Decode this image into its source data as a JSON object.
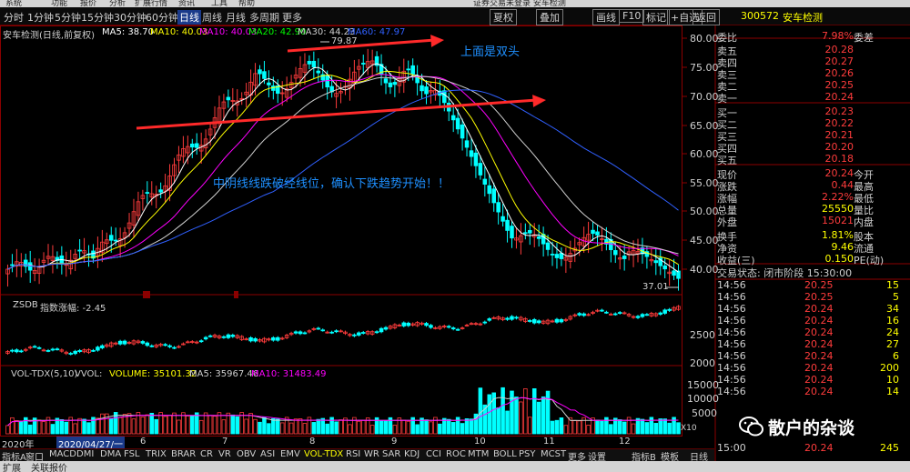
{
  "menu": [
    "系统",
    "功能",
    "报价",
    "分析",
    "扩展行情",
    "资讯",
    "工具",
    "帮助"
  ],
  "window_title": "证券交易未登录  安车检测",
  "periods": [
    {
      "label": "分时",
      "active": false
    },
    {
      "label": "1分钟",
      "active": false
    },
    {
      "label": "5分钟",
      "active": false
    },
    {
      "label": "15分钟",
      "active": false
    },
    {
      "label": "30分钟",
      "active": false
    },
    {
      "label": "60分钟",
      "active": false
    },
    {
      "label": "日线",
      "active": true
    },
    {
      "label": "周线",
      "active": false
    },
    {
      "label": "月线",
      "active": false
    },
    {
      "label": "多周期",
      "active": false
    },
    {
      "label": "更多",
      "active": false
    }
  ],
  "right_toolbar": [
    "夏权",
    "叠加",
    "画线",
    "F10",
    "标记",
    "+自选",
    "返回"
  ],
  "quote_header": {
    "code": "300572",
    "name": "安车检测"
  },
  "chart_header": {
    "name": "安车检测(日线,前复权)",
    "ma5": "MA5: 38.70",
    "ma10": "MA10: 40.03",
    "ma10b": "MA10: 40.03",
    "ma20": "MA20: 42.90",
    "ma30": "MA30: 44.23",
    "ma60": "MA60: 47.97"
  },
  "annotations": {
    "top": "上面是双头",
    "mid": "中阴线线跌破经线位，确认下跌趋势开始！！",
    "high": "79.87",
    "low": "37.01"
  },
  "price_axis": [
    "80.00",
    "75.00",
    "70.00",
    "65.00",
    "60.00",
    "55.00",
    "50.00",
    "45.00",
    "40.00"
  ],
  "zsdb": {
    "name": "ZSDB",
    "label": "指数涨幅: -2.45",
    "axis": [
      "2500",
      "2000"
    ]
  },
  "vol": {
    "name": "VOL-TDX(5,10)",
    "vvol": "VVOL: ",
    "volume": "VOLUME: 35101.32",
    "ma5": "MA5: 35967.46",
    "ma10": "MA10: 31483.49",
    "axis": [
      "15000",
      "10000",
      "5000"
    ],
    "unit": "X10"
  },
  "x_axis": {
    "start": "2020年",
    "selected_date": "2020/04/27/一",
    "months": [
      "6",
      "7",
      "8",
      "9",
      "10",
      "11",
      "12"
    ]
  },
  "quote": {
    "webi": {
      "label": "委比",
      "value": "7.98%",
      "label2": "委差"
    },
    "asks": [
      {
        "label": "卖五",
        "price": "20.28"
      },
      {
        "label": "卖四",
        "price": "20.27"
      },
      {
        "label": "卖三",
        "price": "20.26"
      },
      {
        "label": "卖二",
        "price": "20.25"
      },
      {
        "label": "卖一",
        "price": "20.24"
      }
    ],
    "bids": [
      {
        "label": "买一",
        "price": "20.23"
      },
      {
        "label": "买二",
        "price": "20.22"
      },
      {
        "label": "买三",
        "price": "20.21"
      },
      {
        "label": "买四",
        "price": "20.20"
      },
      {
        "label": "买五",
        "price": "20.18"
      }
    ],
    "stats": [
      {
        "label": "现价",
        "value": "20.24",
        "label2": "今开",
        "color": "red"
      },
      {
        "label": "涨跌",
        "value": "0.44",
        "label2": "最高",
        "color": "red"
      },
      {
        "label": "涨幅",
        "value": "2.22%",
        "label2": "最低",
        "color": "red"
      },
      {
        "label": "总量",
        "value": "25550",
        "label2": "量比",
        "color": "yellow"
      },
      {
        "label": "外盘",
        "value": "15021",
        "label2": "内盘",
        "color": "red"
      }
    ],
    "stats2": [
      {
        "label": "换手",
        "value": "1.81%",
        "label2": "股本",
        "color": "yellow"
      },
      {
        "label": "净资",
        "value": "9.46",
        "label2": "流通",
        "color": "yellow"
      },
      {
        "label": "收益(三)",
        "value": "0.150",
        "label2": "PE(动)",
        "color": "yellow"
      }
    ],
    "trade_state": "交易状态: 闭市阶段  15:30:00"
  },
  "ticks": [
    {
      "time": "14:56",
      "price": "20.25",
      "vol": "15"
    },
    {
      "time": "14:56",
      "price": "20.25",
      "vol": "5"
    },
    {
      "time": "14:56",
      "price": "20.24",
      "vol": "34"
    },
    {
      "time": "14:56",
      "price": "20.24",
      "vol": "16"
    },
    {
      "time": "14:56",
      "price": "20.24",
      "vol": "24"
    },
    {
      "time": "14:56",
      "price": "20.24",
      "vol": "27"
    },
    {
      "time": "14:56",
      "price": "20.24",
      "vol": "6"
    },
    {
      "time": "14:56",
      "price": "20.24",
      "vol": "200"
    },
    {
      "time": "14:56",
      "price": "20.24",
      "vol": "10"
    },
    {
      "time": "14:56",
      "price": "20.24",
      "vol": "14"
    },
    {
      "time": "15:00",
      "price": "20.24",
      "vol": "245"
    }
  ],
  "indicators": [
    "指标A",
    "窗口",
    "MACD",
    "DMI",
    "DMA",
    "FSL",
    "TRIX",
    "BRAR",
    "CR",
    "VR",
    "OBV",
    "ASI",
    "EMV",
    "VOL-TDX",
    "RSI",
    "WR",
    "SAR",
    "KDJ",
    "CCI",
    "ROC",
    "MTM",
    "BOLL",
    "PSY",
    "MCST",
    "更多",
    "设置"
  ],
  "indicators_right": [
    "指标B",
    "模板",
    "日线"
  ],
  "status": [
    "扩展",
    "关联报价"
  ],
  "watermark": "散户的杂谈",
  "colors": {
    "up": "#ff3c3c",
    "down": "#00ffff",
    "ma5": "#ffffff",
    "ma10": "#ffff00",
    "ma20": "#ff00ff",
    "ma30": "#00ff00",
    "ma60": "#3060ff",
    "arrow": "#ff2a2a",
    "note": "#1e90ff"
  }
}
